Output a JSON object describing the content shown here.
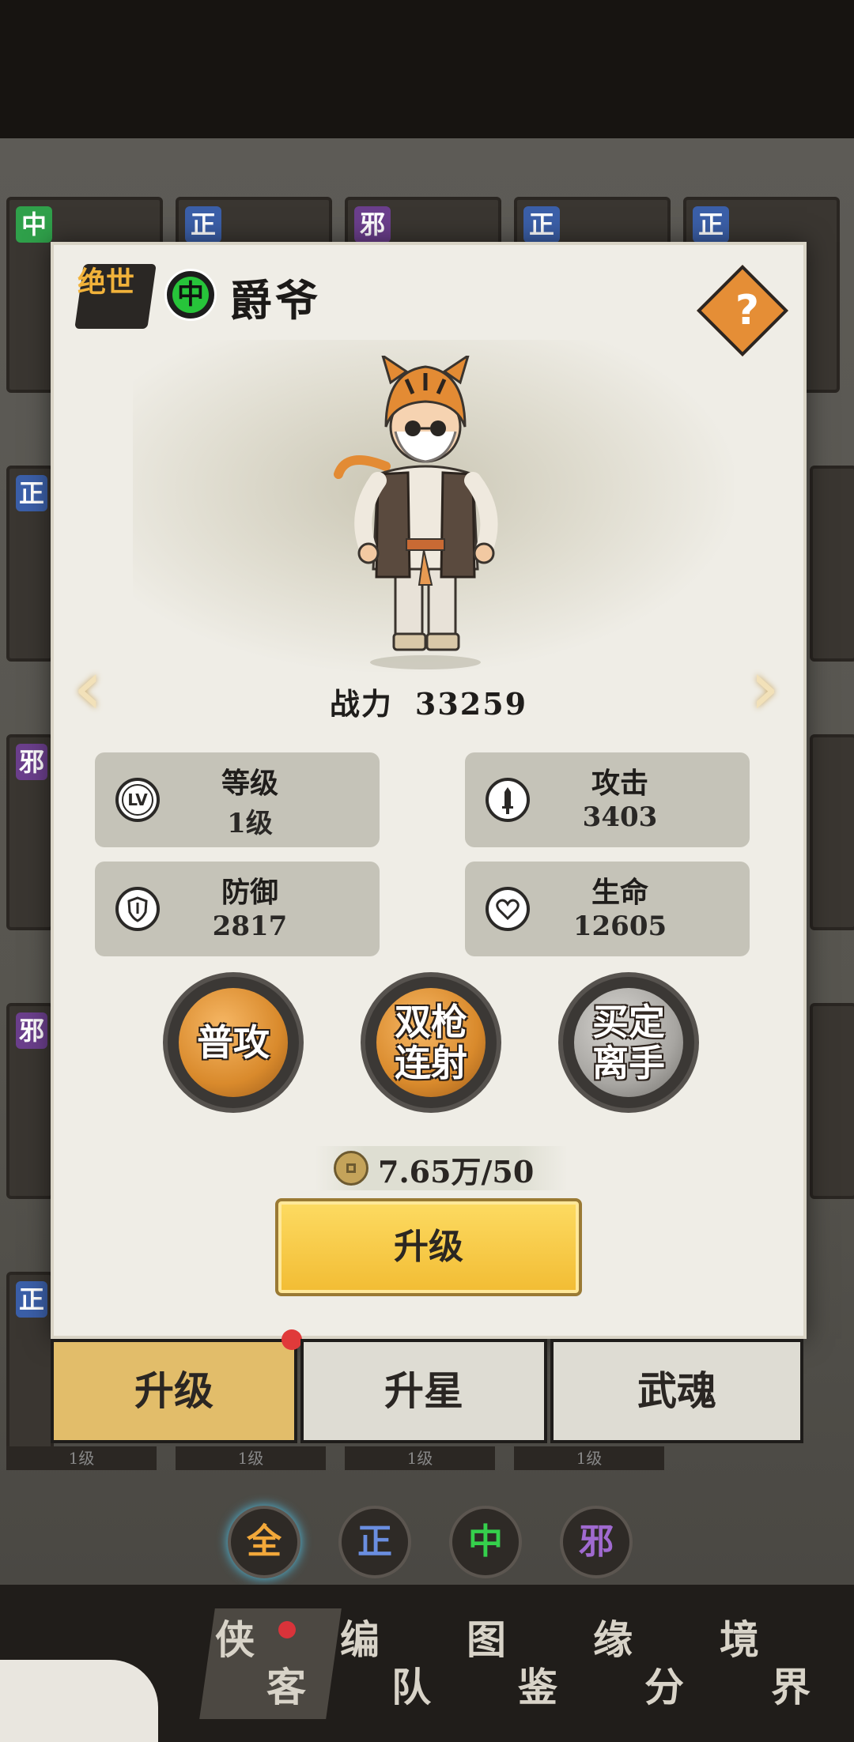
{
  "hero": {
    "grade": "绝世",
    "faction": "中",
    "name": "爵爷",
    "power_label": "战力",
    "power_value": "33259"
  },
  "help_icon_glyph": "?",
  "nav_arrows": {
    "prev": "‹",
    "next": "›"
  },
  "stats": [
    {
      "icon": "lv-icon",
      "icon_text": "LV",
      "label": "等级",
      "value": "1级"
    },
    {
      "icon": "sword-icon",
      "icon_text": "",
      "label": "攻击",
      "value": "3403"
    },
    {
      "icon": "shield-icon",
      "icon_text": "",
      "label": "防御",
      "value": "2817"
    },
    {
      "icon": "heart-icon",
      "icon_text": "",
      "label": "生命",
      "value": "12605"
    }
  ],
  "skills": [
    {
      "name": "普攻",
      "line1": "普攻",
      "line2": ""
    },
    {
      "name": "双枪连射",
      "line1": "双枪",
      "line2": "连射"
    },
    {
      "name": "买定离手",
      "line1": "买定",
      "line2": "离手"
    }
  ],
  "cost": {
    "text": "7.65万/50"
  },
  "upgrade_button": "升级",
  "tabs": [
    {
      "label": "升级",
      "active": true
    },
    {
      "label": "升星",
      "active": false
    },
    {
      "label": "武魂",
      "active": false
    }
  ],
  "background": {
    "cards_top": [
      "中",
      "正",
      "邪",
      "正",
      "正"
    ],
    "side_tags": [
      "正",
      "邪",
      "邪",
      "正"
    ],
    "levels": [
      "1级",
      "1级",
      "1级",
      "1级"
    ],
    "filters": [
      "全",
      "正",
      "中",
      "邪"
    ],
    "bottom_nav": [
      {
        "c1": "侠",
        "c2": "客"
      },
      {
        "c1": "编",
        "c2": "队"
      },
      {
        "c1": "图",
        "c2": "鉴"
      },
      {
        "c1": "缘",
        "c2": "分"
      },
      {
        "c1": "境",
        "c2": "界"
      }
    ]
  },
  "colors": {
    "panel": "#efede6",
    "accent_gold": "#f2bc33",
    "faction_green": "#27c43a",
    "help_orange": "#e58e36",
    "tab_active": "#e2bd6a",
    "tab_inactive": "#dedcd3",
    "skill_orange": "#d98a2c",
    "skill_grey": "#a8a6a2"
  }
}
